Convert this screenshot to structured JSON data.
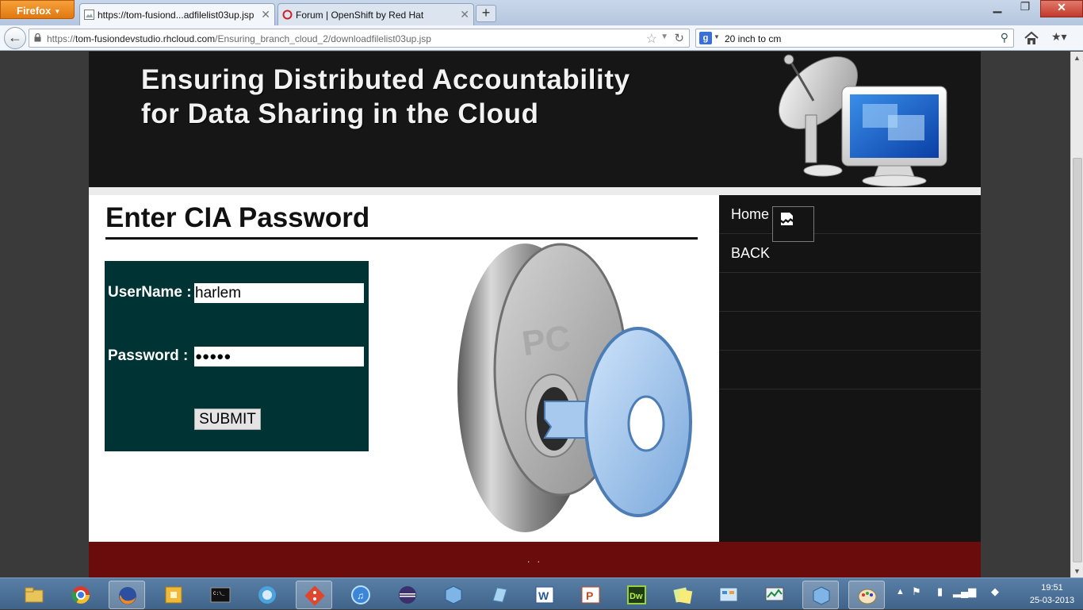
{
  "browser": {
    "firefox_menu": "Firefox",
    "tabs": [
      {
        "label": "https://tom-fusiond...adfilelist03up.jsp",
        "active": true
      },
      {
        "label": "Forum | OpenShift by Red Hat",
        "active": false
      }
    ],
    "url_prefix": "https://",
    "url_host": "tom-fusiondevstudio.rhcloud.com",
    "url_path": "/Ensuring_branch_cloud_2/downloadfilelist03up.jsp",
    "search_value": "20 inch to cm",
    "search_engine_icon": "g-icon"
  },
  "header": {
    "title_line1": "Ensuring Distributed Accountability",
    "title_line2": "for Data Sharing in the Cloud"
  },
  "main": {
    "page_title": "Enter CIA Password",
    "form": {
      "username_label": "UserName :",
      "username_value": "harlem",
      "password_label": "Password  :",
      "password_value": "●●●●●",
      "submit_label": "SUBMIT"
    }
  },
  "sidebar": {
    "items": [
      {
        "label": "Home"
      },
      {
        "label": "BACK"
      },
      {
        "label": ""
      },
      {
        "label": ""
      },
      {
        "label": ""
      }
    ]
  },
  "footer": {
    "text": ". ."
  },
  "taskbar": {
    "time": "19:51",
    "date": "25-03-2013"
  },
  "colors": {
    "header_bg": "#161616",
    "login_box_bg": "#003333",
    "sidebar_bg": "#141414",
    "footer_bg": "#6b0c0c",
    "firefox_button": "#e8871e"
  }
}
